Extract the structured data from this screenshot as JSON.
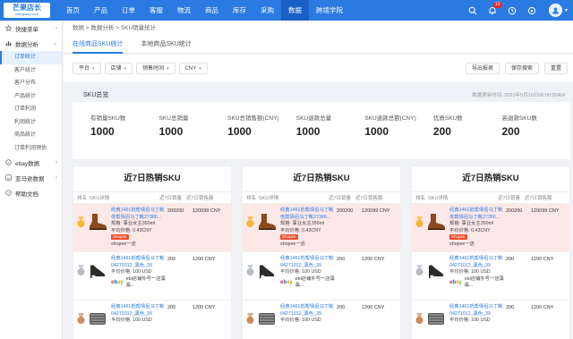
{
  "brand": {
    "title": "芒果店长",
    "subtitle": "mangoerp.com"
  },
  "nav": [
    "首页",
    "产品",
    "订单",
    "客服",
    "物流",
    "商品",
    "库存",
    "采购",
    "数据",
    "跨境学院"
  ],
  "nav_active_index": 8,
  "notification_count": "10",
  "sidebar": {
    "groups": [
      {
        "label": "快捷菜单",
        "icon": "star-icon"
      },
      {
        "label": "数据分析",
        "icon": "chart-icon"
      }
    ],
    "items": [
      "订单统计",
      "客户统计",
      "客户分布",
      "产品统计",
      "订单利润",
      "利润统计",
      "商品统计",
      "订单利润预估"
    ],
    "active_item": 0,
    "bottom_groups": [
      {
        "label": "ebay数据",
        "icon": "ebay-icon"
      },
      {
        "label": "亚马逊数据",
        "icon": "amazon-icon"
      },
      {
        "label": "帮助文档",
        "icon": "help-icon"
      }
    ]
  },
  "breadcrumb": "数据 > 数据分析 > SKU销量统计",
  "tabs": [
    "在线商品SKU统计",
    "本地商品SKU统计"
  ],
  "filters": [
    "平台",
    "店铺",
    "销售时间",
    "CNY"
  ],
  "actions": [
    "导出报表",
    "保存搜索",
    "重置"
  ],
  "summary": {
    "title": "SKU总览",
    "updated": "数据更新时间: 2021年5月10日06:00:00AM",
    "metrics": [
      {
        "label": "有销量SKU数",
        "value": "1000"
      },
      {
        "label": "SKU总销量",
        "value": "1000"
      },
      {
        "label": "SKU总销售额(CNY)",
        "value": "1000"
      },
      {
        "label": "SKU退款总量",
        "value": "1000"
      },
      {
        "label": "SKU退款总额(CNY)",
        "value": "1000"
      },
      {
        "label": "优质SKU数",
        "value": "200"
      },
      {
        "label": "高退款SKU数",
        "value": "200"
      }
    ]
  },
  "cards": [
    {
      "title": "近7日热销SKU"
    },
    {
      "title": "近7日热销SKU"
    },
    {
      "title": "近7日热销SKU"
    }
  ],
  "columns": [
    "排名",
    "SKU详情",
    "近7日销量",
    "近7日销售额"
  ],
  "rows": [
    {
      "t1": "经典1461抵帮情侣马丁靴",
      "t2": "低帮情侣马丁靴27366...",
      "spec": "规格: 事业女主350ml",
      "price": "平均价格: 0.43CNY",
      "shop": "shopee一店",
      "platform": "Shopee",
      "qty": "200200",
      "amt": "120099 CNY",
      "rank": "gold"
    },
    {
      "t1": "经典1461抵帮情侣马丁靴",
      "t2": "04271012_黑色_39",
      "spec": "平均价格: 100 USD",
      "price": "",
      "shop": "ebi店铺外号一店藻桑...",
      "platform": "ebay",
      "qty": "200",
      "amt": "1200 CNY",
      "rank": "silver"
    },
    {
      "t1": "经典1461抵帮情侣马丁靴",
      "t2": "04271012_黑色_39",
      "spec": "平均价格: 100 USD",
      "price": "",
      "shop": "",
      "platform": "",
      "qty": "200",
      "amt": "1200 CNY",
      "rank": "bronze"
    }
  ],
  "card_row_variants": [
    {
      "row1": {
        "t1": "经典1461抵帮情侣马丁靴",
        "t2": "低帮情侣马丁靴27366...",
        "spec": "规格: 事业女主350ml",
        "price": "平均价格: 0.43CNY",
        "shop": "shopee一店",
        "qty": "200200",
        "amt": "120099 CNY"
      },
      "row2": {
        "t1": "经典1461抵帮情侣马丁靴",
        "t2": "04271012_黑色_39",
        "spec": "平均价格: 100 USD",
        "shop": "ebi店铺外号一店藻桑...",
        "qty": "200",
        "amt": "1200 CNY"
      }
    },
    {
      "row1": {
        "t1": "经典1461抵帮情侣马丁靴",
        "t2": "低帮情侣马丁靴27366...",
        "spec": "规格: 事业女主350ml",
        "price": "平均价格: 0.43CNY",
        "shop": "shopee一店",
        "qty": "200200",
        "amt": "120099 CNY"
      },
      "row2": {
        "t1": "经典1461抵帮情侣马丁靴",
        "t2": "04271012_黑色_39",
        "spec": "平均价格: 100 USD",
        "shop": "ebi店铺外号一店藻桑...",
        "qty": "200",
        "amt": "1200 CNY"
      }
    },
    {
      "row1": {
        "t1": "经典1461抵帮情侣马丁靴",
        "t2": "低帮情侣马丁靴27366...",
        "spec": "规格: 事业女主350ml",
        "price": "平均价格: 0.43CNY",
        "shop": "shopee一店",
        "qty": "200200",
        "amt": "120099 CNY"
      },
      "row2": {
        "t1": "经典1461抵帮情侣马丁靴",
        "t2": "04271012_黑色_39",
        "spec": "平均价格: 100 USD",
        "shop": "ebi店铺外号一店藻桑...",
        "qty": "200",
        "amt": "1200 CNY"
      }
    }
  ],
  "colors": {
    "primary": "#2a7ae2",
    "nav_active": "#1a5fc4",
    "highlight_row": "#fde8e8",
    "shopee": "#ee4d2d"
  }
}
